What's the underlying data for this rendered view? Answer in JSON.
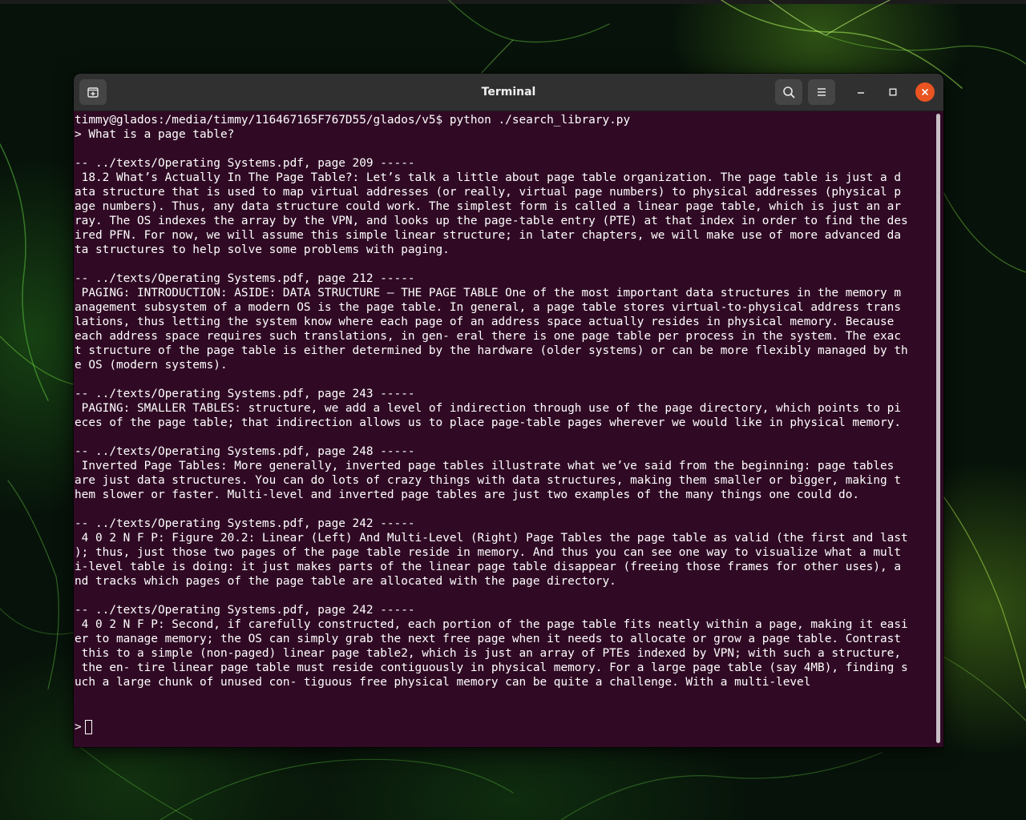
{
  "window": {
    "title": "Terminal"
  },
  "icons": {
    "new_tab": "new-tab-icon",
    "search": "search-icon",
    "menu": "hamburger-menu-icon",
    "minimize": "minimize-icon",
    "maximize": "maximize-icon",
    "close": "close-icon"
  },
  "colors": {
    "terminal_bg": "#300a24",
    "headerbar_bg": "#303030",
    "close_button": "#e95420",
    "text": "#ffffff"
  },
  "terminal": {
    "lines": [
      "timmy@glados:/media/timmy/116467165F767D55/glados/v5$ python ./search_library.py",
      "> What is a page table?",
      "",
      "-- ../texts/Operating Systems.pdf, page 209 -----",
      " 18.2 What’s Actually In The Page Table?: Let’s talk a little about page table organization. The page table is just a d",
      "ata structure that is used to map virtual addresses (or really, virtual page numbers) to physical addresses (physical p",
      "age numbers). Thus, any data structure could work. The simplest form is called a linear page table, which is just an ar",
      "ray. The OS indexes the array by the VPN, and looks up the page-table entry (PTE) at that index in order to find the des",
      "ired PFN. For now, we will assume this simple linear structure; in later chapters, we will make use of more advanced da",
      "ta structures to help solve some problems with paging.",
      "",
      "-- ../texts/Operating Systems.pdf, page 212 -----",
      " PAGING: INTRODUCTION: ASIDE: DATA STRUCTURE – THE PAGE TABLE One of the most important data structures in the memory m",
      "anagement subsystem of a modern OS is the page table. In general, a page table stores virtual-to-physical address trans",
      "lations, thus letting the system know where each page of an address space actually resides in physical memory. Because",
      "each address space requires such translations, in gen- eral there is one page table per process in the system. The exac",
      "t structure of the page table is either determined by the hardware (older systems) or can be more flexibly managed by th",
      "e OS (modern systems).",
      "",
      "-- ../texts/Operating Systems.pdf, page 243 -----",
      " PAGING: SMALLER TABLES: structure, we add a level of indirection through use of the page directory, which points to pi",
      "eces of the page table; that indirection allows us to place page-table pages wherever we would like in physical memory.",
      "",
      "-- ../texts/Operating Systems.pdf, page 248 -----",
      " Inverted Page Tables: More generally, inverted page tables illustrate what we’ve said from the beginning: page tables",
      "are just data structures. You can do lots of crazy things with data structures, making them smaller or bigger, making t",
      "hem slower or faster. Multi-level and inverted page tables are just two examples of the many things one could do.",
      "",
      "-- ../texts/Operating Systems.pdf, page 242 -----",
      " 4 0 2 N F P: Figure 20.2: Linear (Left) And Multi-Level (Right) Page Tables the page table as valid (the first and last",
      "); thus, just those two pages of the page table reside in memory. And thus you can see one way to visualize what a mult",
      "i-level table is doing: it just makes parts of the linear page table disappear (freeing those frames for other uses), a",
      "nd tracks which pages of the page table are allocated with the page directory.",
      "",
      "-- ../texts/Operating Systems.pdf, page 242 -----",
      " 4 0 2 N F P: Second, if carefully constructed, each portion of the page table fits neatly within a page, making it easi",
      "er to manage memory; the OS can simply grab the next free page when it needs to allocate or grow a page table. Contrast",
      " this to a simple (non-paged) linear page table2, which is just an array of PTEs indexed by VPN; with such a structure,",
      " the en- tire linear page table must reside contiguously in physical memory. For a large page table (say 4MB), finding s",
      "uch a large chunk of unused con- tiguous free physical memory can be quite a challenge. With a multi-level",
      "",
      ""
    ],
    "prompt": ">"
  }
}
